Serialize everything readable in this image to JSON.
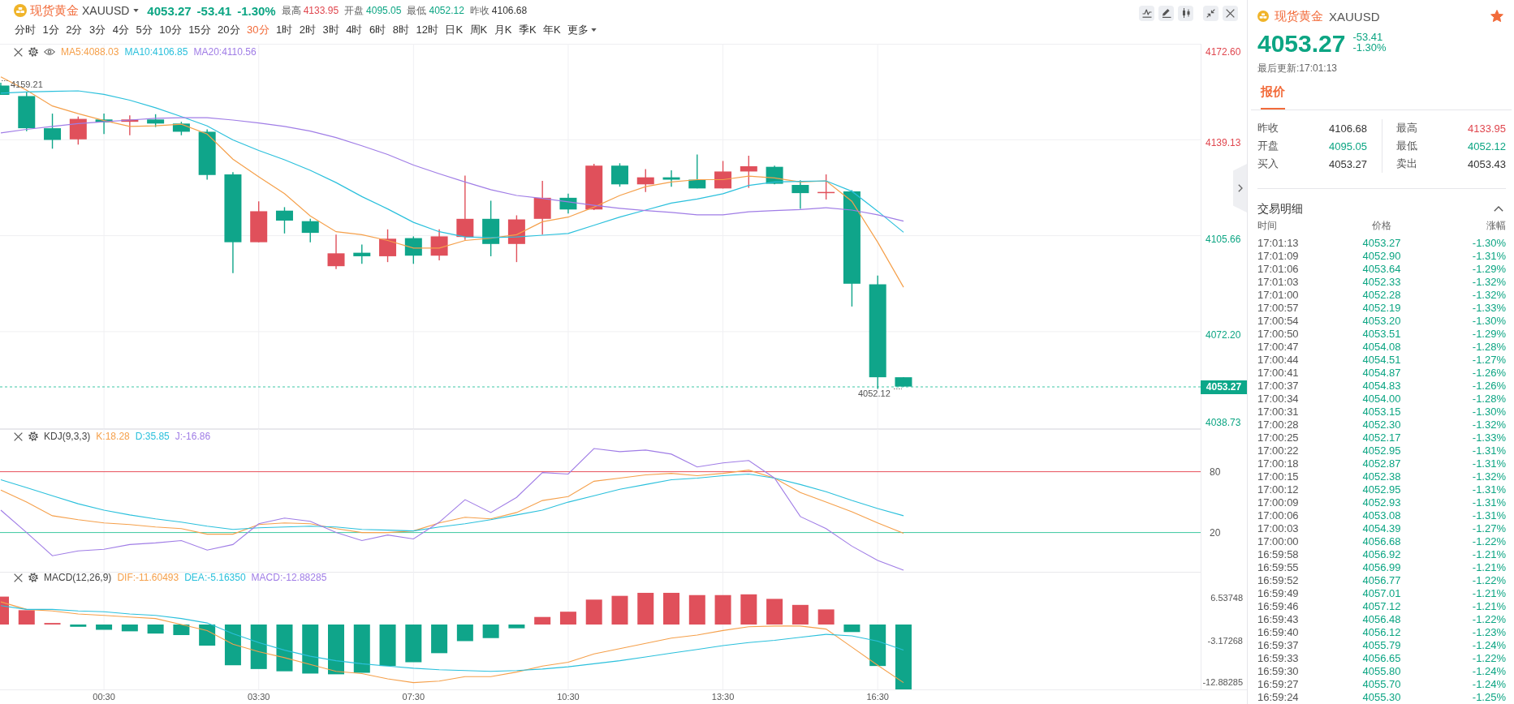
{
  "header": {
    "name": "现货黄金",
    "symbol": "XAUUSD",
    "price": "4053.27",
    "change": "-53.41",
    "change_pct": "-1.30%",
    "color": "#0ca583",
    "stats": [
      {
        "label": "最高",
        "value": "4133.95",
        "color": "#e0474f"
      },
      {
        "label": "开盘",
        "value": "4095.05",
        "color": "#0ca583"
      },
      {
        "label": "最低",
        "value": "4052.12",
        "color": "#0ca583"
      },
      {
        "label": "昨收",
        "value": "4106.68",
        "color": "#333333"
      }
    ]
  },
  "periods": [
    {
      "label": "分时",
      "kind": "period",
      "selected": false
    },
    {
      "label": "1分",
      "kind": "period",
      "selected": false
    },
    {
      "label": "2分",
      "kind": "period",
      "selected": false
    },
    {
      "label": "3分",
      "kind": "period",
      "selected": false
    },
    {
      "label": "4分",
      "kind": "period",
      "selected": false
    },
    {
      "label": "5分",
      "kind": "period",
      "selected": false
    },
    {
      "label": "10分",
      "kind": "period",
      "selected": false
    },
    {
      "label": "15分",
      "kind": "period",
      "selected": false
    },
    {
      "label": "20分",
      "kind": "period",
      "selected": false
    },
    {
      "label": "30分",
      "kind": "period",
      "selected": true
    },
    {
      "label": "1时",
      "kind": "period",
      "selected": false
    },
    {
      "label": "2时",
      "kind": "period",
      "selected": false
    },
    {
      "label": "3时",
      "kind": "period",
      "selected": false
    },
    {
      "label": "4时",
      "kind": "period",
      "selected": false
    },
    {
      "label": "6时",
      "kind": "period",
      "selected": false
    },
    {
      "label": "8时",
      "kind": "period",
      "selected": false
    },
    {
      "label": "12时",
      "kind": "period",
      "selected": false
    },
    {
      "label": "日K",
      "kind": "period",
      "selected": false
    },
    {
      "label": "周K",
      "kind": "period",
      "selected": false
    },
    {
      "label": "月K",
      "kind": "period",
      "selected": false
    },
    {
      "label": "季K",
      "kind": "period",
      "selected": false
    },
    {
      "label": "年K",
      "kind": "period",
      "selected": false
    },
    {
      "label": "更多",
      "kind": "menu",
      "selected": false
    }
  ],
  "main_chart": {
    "legend": [
      {
        "label": "MA5:4088.03",
        "color": "#f5a04b"
      },
      {
        "label": "MA10:4106.85",
        "color": "#2bc0dc"
      },
      {
        "label": "MA20:4110.56",
        "color": "#a07de6"
      }
    ],
    "price_axis": [
      {
        "label": "4172.60",
        "color": "#e0474f"
      },
      {
        "label": "4139.13",
        "color": "#e0474f"
      },
      {
        "label": "4105.66",
        "color": "#0ca583"
      },
      {
        "label": "4072.20",
        "color": "#0ca583"
      },
      {
        "label": "4038.73",
        "color": "#0ca583"
      }
    ],
    "current_price": "4053.27",
    "high_label": "4159.21",
    "low_label": "4052.12"
  },
  "kdj": {
    "title": "KDJ(9,3,3)",
    "legend": [
      {
        "label": "K:18.28",
        "color": "#f5a04b"
      },
      {
        "label": "D:35.85",
        "color": "#2bc0dc"
      },
      {
        "label": "J:-16.86",
        "color": "#a07de6"
      }
    ],
    "axis": [
      "80",
      "20"
    ]
  },
  "macd": {
    "title": "MACD(12,26,9)",
    "legend": [
      {
        "label": "DIF:-11.60493",
        "color": "#f5a04b"
      },
      {
        "label": "DEA:-5.16350",
        "color": "#2bc0dc"
      },
      {
        "label": "MACD:-12.88285",
        "color": "#a07de6"
      }
    ],
    "axis": [
      "6.53748",
      "-3.17268",
      "-12.88285"
    ]
  },
  "time_axis": [
    "00:30",
    "03:30",
    "07:30",
    "10:30",
    "13:30",
    "16:30"
  ],
  "quote_panel": {
    "name": "现货黄金",
    "symbol": "XAUUSD",
    "starred": true,
    "price": "4053.27",
    "change": "-53.41",
    "change_pct": "-1.30%",
    "color": "#0ca583",
    "updated": "最后更新:17:01:13",
    "tabs": [
      {
        "label": "报价",
        "selected": true
      }
    ],
    "stats": [
      {
        "label": "昨收",
        "value": "4106.68",
        "color": "#333333"
      },
      {
        "label": "最高",
        "value": "4133.95",
        "color": "#e0474f"
      },
      {
        "label": "开盘",
        "value": "4095.05",
        "color": "#0ca583"
      },
      {
        "label": "最低",
        "value": "4052.12",
        "color": "#0ca583"
      },
      {
        "label": "买入",
        "value": "4053.27",
        "color": "#333333"
      },
      {
        "label": "卖出",
        "value": "4053.43",
        "color": "#333333"
      }
    ],
    "trades": {
      "title": "交易明细",
      "expanded": true,
      "columns": [
        "时间",
        "价格",
        "涨幅"
      ],
      "rows": [
        {
          "time": "17:01:13",
          "price": "4053.27",
          "change": "-1.30%",
          "color": "#0ca583"
        },
        {
          "time": "17:01:09",
          "price": "4052.90",
          "change": "-1.31%",
          "color": "#0ca583"
        },
        {
          "time": "17:01:06",
          "price": "4053.64",
          "change": "-1.29%",
          "color": "#0ca583"
        },
        {
          "time": "17:01:03",
          "price": "4052.33",
          "change": "-1.32%",
          "color": "#0ca583"
        },
        {
          "time": "17:01:00",
          "price": "4052.28",
          "change": "-1.32%",
          "color": "#0ca583"
        },
        {
          "time": "17:00:57",
          "price": "4052.19",
          "change": "-1.33%",
          "color": "#0ca583"
        },
        {
          "time": "17:00:54",
          "price": "4053.20",
          "change": "-1.30%",
          "color": "#0ca583"
        },
        {
          "time": "17:00:50",
          "price": "4053.51",
          "change": "-1.29%",
          "color": "#0ca583"
        },
        {
          "time": "17:00:47",
          "price": "4054.08",
          "change": "-1.28%",
          "color": "#0ca583"
        },
        {
          "time": "17:00:44",
          "price": "4054.51",
          "change": "-1.27%",
          "color": "#0ca583"
        },
        {
          "time": "17:00:41",
          "price": "4054.87",
          "change": "-1.26%",
          "color": "#0ca583"
        },
        {
          "time": "17:00:37",
          "price": "4054.83",
          "change": "-1.26%",
          "color": "#0ca583"
        },
        {
          "time": "17:00:34",
          "price": "4054.00",
          "change": "-1.28%",
          "color": "#0ca583"
        },
        {
          "time": "17:00:31",
          "price": "4053.15",
          "change": "-1.30%",
          "color": "#0ca583"
        },
        {
          "time": "17:00:28",
          "price": "4052.30",
          "change": "-1.32%",
          "color": "#0ca583"
        },
        {
          "time": "17:00:25",
          "price": "4052.17",
          "change": "-1.33%",
          "color": "#0ca583"
        },
        {
          "time": "17:00:22",
          "price": "4052.95",
          "change": "-1.31%",
          "color": "#0ca583"
        },
        {
          "time": "17:00:18",
          "price": "4052.87",
          "change": "-1.31%",
          "color": "#0ca583"
        },
        {
          "time": "17:00:15",
          "price": "4052.38",
          "change": "-1.32%",
          "color": "#0ca583"
        },
        {
          "time": "17:00:12",
          "price": "4052.95",
          "change": "-1.31%",
          "color": "#0ca583"
        },
        {
          "time": "17:00:09",
          "price": "4052.93",
          "change": "-1.31%",
          "color": "#0ca583"
        },
        {
          "time": "17:00:06",
          "price": "4053.08",
          "change": "-1.31%",
          "color": "#0ca583"
        },
        {
          "time": "17:00:03",
          "price": "4054.39",
          "change": "-1.27%",
          "color": "#0ca583"
        },
        {
          "time": "17:00:00",
          "price": "4056.68",
          "change": "-1.22%",
          "color": "#0ca583"
        },
        {
          "time": "16:59:58",
          "price": "4056.92",
          "change": "-1.21%",
          "color": "#0ca583"
        },
        {
          "time": "16:59:55",
          "price": "4056.99",
          "change": "-1.21%",
          "color": "#0ca583"
        },
        {
          "time": "16:59:52",
          "price": "4056.77",
          "change": "-1.22%",
          "color": "#0ca583"
        },
        {
          "time": "16:59:49",
          "price": "4057.01",
          "change": "-1.21%",
          "color": "#0ca583"
        },
        {
          "time": "16:59:46",
          "price": "4057.12",
          "change": "-1.21%",
          "color": "#0ca583"
        },
        {
          "time": "16:59:43",
          "price": "4056.48",
          "change": "-1.22%",
          "color": "#0ca583"
        },
        {
          "time": "16:59:40",
          "price": "4056.12",
          "change": "-1.23%",
          "color": "#0ca583"
        },
        {
          "time": "16:59:37",
          "price": "4055.79",
          "change": "-1.24%",
          "color": "#0ca583"
        },
        {
          "time": "16:59:33",
          "price": "4056.65",
          "change": "-1.22%",
          "color": "#0ca583"
        },
        {
          "time": "16:59:30",
          "price": "4055.80",
          "change": "-1.24%",
          "color": "#0ca583"
        },
        {
          "time": "16:59:27",
          "price": "4055.70",
          "change": "-1.24%",
          "color": "#0ca583"
        },
        {
          "time": "16:59:24",
          "price": "4055.30",
          "change": "-1.25%",
          "color": "#0ca583"
        }
      ]
    }
  }
}
